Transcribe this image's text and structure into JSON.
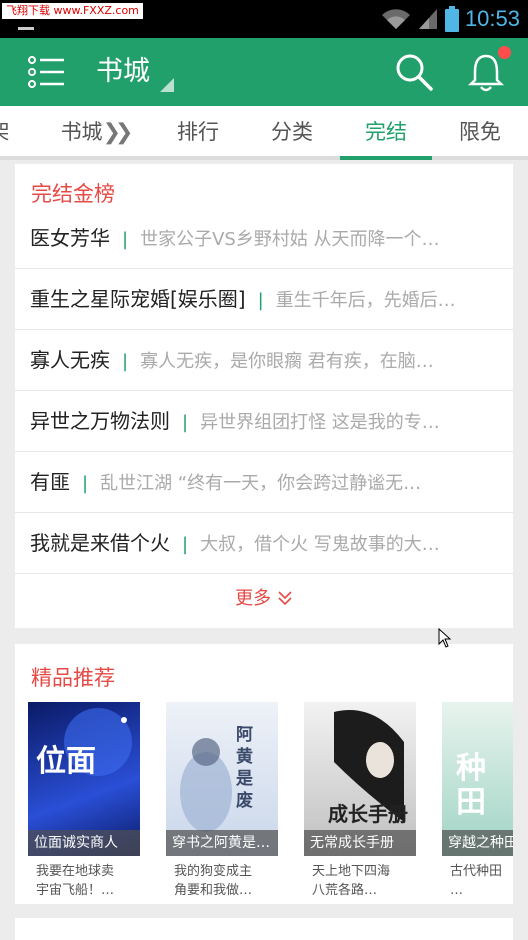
{
  "status_bar": {
    "watermark": "飞翔下载 www.FXXZ.com",
    "time": "10:53"
  },
  "app_bar": {
    "title": "书城"
  },
  "tabs": [
    {
      "label": "架"
    },
    {
      "label": "书城"
    },
    {
      "label": "排行"
    },
    {
      "label": "分类"
    },
    {
      "label": "完结"
    },
    {
      "label": "限免"
    }
  ],
  "finished_section": {
    "title": "完结金榜",
    "items": [
      {
        "name": "医女芳华",
        "desc": "世家公子VS乡野村姑  从天而降一个…"
      },
      {
        "name": "重生之星际宠婚[娱乐圈]",
        "desc": "重生千年后，先婚后…"
      },
      {
        "name": "寡人无疾",
        "desc": "寡人无疾，是你眼瘸  君有疾，在脑…"
      },
      {
        "name": "异世之万物法则",
        "desc": "异世界组团打怪  这是我的专…"
      },
      {
        "name": "有匪",
        "desc": "乱世江湖    “终有一天，你会跨过静谧无…"
      },
      {
        "name": "我就是来借个火",
        "desc": "大叔，借个火  写鬼故事的大…"
      }
    ],
    "more_label": "更多"
  },
  "recommend_section": {
    "title": "精品推荐",
    "books": [
      {
        "caption": "位面诚实商人",
        "desc": "我要在地球卖\n宇宙飞船！…",
        "cover_text": "位面",
        "colors": [
          "#0b1a66",
          "#2a4fd6"
        ]
      },
      {
        "caption": "穿书之阿黄是…",
        "desc": "我的狗变成主\n角要和我做…",
        "cover_text": "阿黄是废",
        "colors": [
          "#c9d6ea",
          "#eef2f8"
        ]
      },
      {
        "caption": "无常成长手册",
        "desc": "天上地下四海\n八荒各路…",
        "cover_text": "成长手册",
        "colors": [
          "#f2f2f2",
          "#bfbfbf"
        ]
      },
      {
        "caption": "穿越之种田",
        "desc": "古代种田\n…",
        "cover_text": "种田",
        "colors": [
          "#9fd3c4",
          "#e8f4ee"
        ]
      }
    ]
  },
  "colors": {
    "primary": "#21a06b",
    "accent_red": "#e64a45",
    "notify_dot": "#ff4d4d"
  }
}
